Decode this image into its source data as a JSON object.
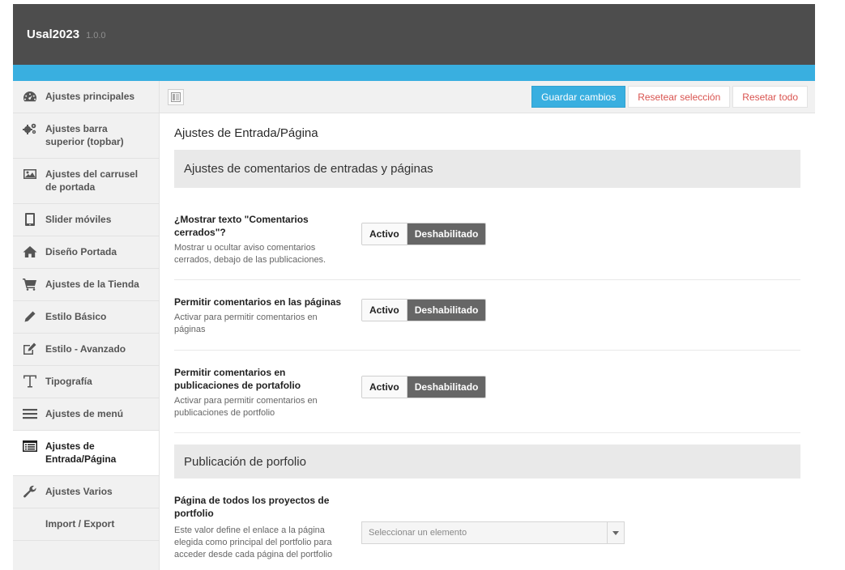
{
  "header": {
    "title": "Usal2023",
    "version": "1.0.0"
  },
  "sidebar": {
    "items": [
      {
        "label": "Ajustes principales",
        "icon": "dashboard-icon"
      },
      {
        "label": "Ajustes barra superior (topbar)",
        "icon": "gears-icon"
      },
      {
        "label": "Ajustes del carrusel de portada",
        "icon": "image-icon"
      },
      {
        "label": "Slider móviles",
        "icon": "tablet-icon"
      },
      {
        "label": "Diseño Portada",
        "icon": "home-icon"
      },
      {
        "label": "Ajustes de la Tienda",
        "icon": "cart-icon"
      },
      {
        "label": "Estilo Básico",
        "icon": "pencil-icon"
      },
      {
        "label": "Estilo - Avanzado",
        "icon": "edit-icon"
      },
      {
        "label": "Tipografía",
        "icon": "text-icon"
      },
      {
        "label": "Ajustes de menú",
        "icon": "menu-icon"
      },
      {
        "label": "Ajustes de Entrada/Página",
        "icon": "list-icon"
      },
      {
        "label": "Ajustes Varios",
        "icon": "wrench-icon"
      },
      {
        "label": "Import / Export",
        "icon": ""
      }
    ]
  },
  "toolbar": {
    "save": "Guardar cambios",
    "reset_section": "Resetear selección",
    "reset_all": "Resetar todo"
  },
  "page": {
    "title": "Ajustes de Entrada/Página",
    "sections": [
      {
        "heading": "Ajustes de comentarios de entradas y páginas"
      },
      {
        "heading": "Publicación de porfolio"
      }
    ],
    "rows": [
      {
        "title": "¿Mostrar texto \"Comentarios cerrados\"?",
        "desc": "Mostrar u ocultar aviso comentarios cerrados, debajo de las publicaciones.",
        "on": "Activo",
        "off": "Deshabilitado"
      },
      {
        "title": "Permitir comentarios en las páginas",
        "desc": "Activar para permitir comentarios en páginas",
        "on": "Activo",
        "off": "Deshabilitado"
      },
      {
        "title": "Permitir comentarios en publicaciones de portafolio",
        "desc": "Activar para permitir comentarios en publicaciones de portfolio",
        "on": "Activo",
        "off": "Deshabilitado"
      }
    ],
    "portfolio_row": {
      "title": "Página de todos los proyectos de portfolio",
      "desc": "Este valor define el enlace a la página elegida como principal del portfolio para acceder desde cada página del portfolio",
      "placeholder": "Seleccionar un elemento"
    }
  },
  "colors": {
    "header_bg": "#4d4d4d",
    "accent": "#39afe0",
    "reset_text": "#d9534f"
  }
}
